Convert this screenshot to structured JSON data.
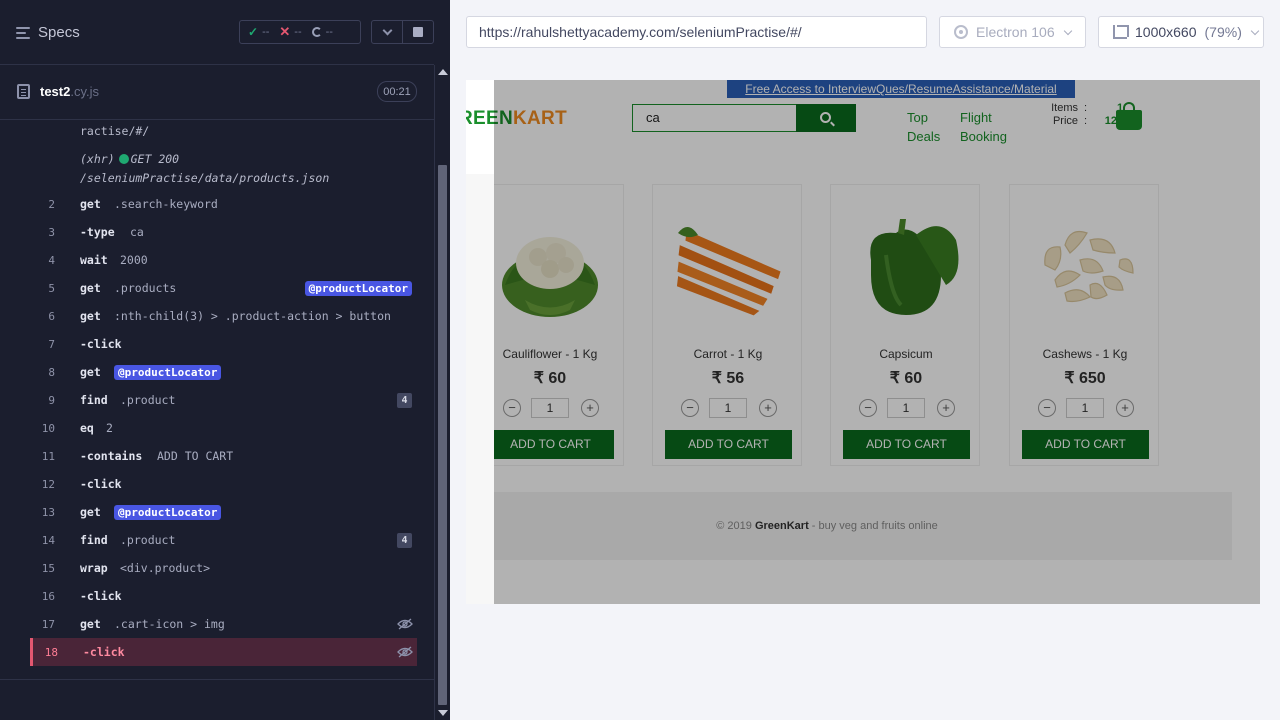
{
  "reporter": {
    "specs_label": "Specs",
    "stats": {
      "passed": "--",
      "failed": "--",
      "pending": "--"
    },
    "spec_file": {
      "name": "test2",
      "ext": ".cy.js",
      "duration": "00:21"
    },
    "prev_lines": [
      "ractise/#/",
      "(xhr)",
      "GET 200",
      "/seleniumPractise/data/products.json"
    ],
    "commands": [
      {
        "num": "2",
        "name": "get",
        "msg": ".search-keyword"
      },
      {
        "num": "3",
        "name": "-type",
        "msg": "ca"
      },
      {
        "num": "4",
        "name": "wait",
        "msg": "2000"
      },
      {
        "num": "5",
        "name": "get",
        "msg": ".products",
        "alias": "@productLocator"
      },
      {
        "num": "6",
        "name": "get",
        "msg": ":nth-child(3) > .product-action > button"
      },
      {
        "num": "7",
        "name": "-click",
        "msg": ""
      },
      {
        "num": "8",
        "name": "get",
        "alias": "@productLocator"
      },
      {
        "num": "9",
        "name": "find",
        "msg": ".product",
        "badge": "4"
      },
      {
        "num": "10",
        "name": "eq",
        "msg": "2"
      },
      {
        "num": "11",
        "name": "-contains",
        "msg": "ADD TO CART"
      },
      {
        "num": "12",
        "name": "-click",
        "msg": ""
      },
      {
        "num": "13",
        "name": "get",
        "alias": "@productLocator"
      },
      {
        "num": "14",
        "name": "find",
        "msg": ".product",
        "badge": "4"
      },
      {
        "num": "15",
        "name": "wrap",
        "msg": "<div.product>"
      },
      {
        "num": "16",
        "name": "-click",
        "msg": ""
      },
      {
        "num": "17",
        "name": "get",
        "msg": ".cart-icon > img",
        "icon": "eye-hidden-icon"
      },
      {
        "num": "18",
        "name": "-click",
        "msg": "",
        "icon": "eye-hidden-icon",
        "active": true
      }
    ]
  },
  "browser": {
    "url": "https://rahulshettyacademy.com/seleniumPractise/#/",
    "engine": "Electron 106",
    "viewport": "1000x660",
    "zoom": "(79%)"
  },
  "aut": {
    "banner": "Free Access to InterviewQues/ResumeAssistance/Material",
    "logo_a": "REEN",
    "logo_b": "KART",
    "search_value": "ca",
    "nav": {
      "top": "Top",
      "deals": "Deals",
      "flight": "Flight",
      "booking": "Booking"
    },
    "cart": {
      "items_label": "Items",
      "items_value": "1",
      "price_label": "Price",
      "price_value": "120"
    },
    "products": [
      {
        "name": "Cauliflower - 1 Kg",
        "price": "₹ 60",
        "qty": "1",
        "button": "ADD TO CART",
        "icon": "cauliflower-icon"
      },
      {
        "name": "Carrot - 1 Kg",
        "price": "₹ 56",
        "qty": "1",
        "button": "ADD TO CART",
        "icon": "carrot-icon"
      },
      {
        "name": "Capsicum",
        "price": "₹ 60",
        "qty": "1",
        "button": "ADD TO CART",
        "icon": "capsicum-icon"
      },
      {
        "name": "Cashews - 1 Kg",
        "price": "₹ 650",
        "qty": "1",
        "button": "ADD TO CART",
        "icon": "cashews-icon"
      }
    ],
    "footer": {
      "prefix": "© 2019",
      "brand": "GreenKart",
      "suffix": "- buy veg and fruits online"
    }
  },
  "colors": {
    "pass": "#1fa971",
    "fail": "#e45770",
    "alias": "#4956e3",
    "brand_green": "#0a6b1d"
  }
}
